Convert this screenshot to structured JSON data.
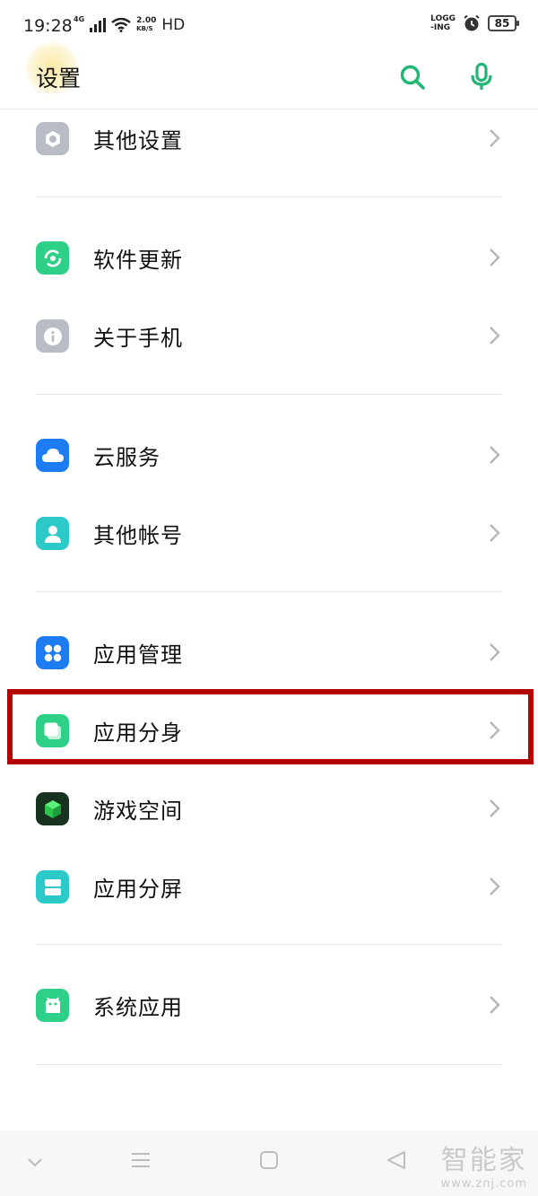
{
  "status_bar": {
    "time": "19:28",
    "network": "4G",
    "speed_value": "2.00",
    "speed_unit": "KB/S",
    "hd": "HD",
    "logging_line1": "LOGG",
    "logging_line2": "-ING",
    "battery": "85"
  },
  "header": {
    "title": "设置",
    "search_icon": "search-icon",
    "mic_icon": "microphone-icon",
    "accent_color": "#22b573"
  },
  "sections": [
    {
      "items": [
        {
          "label": "其他设置",
          "icon": "gear-icon",
          "icon_color": "#b8bcc4"
        }
      ]
    },
    {
      "items": [
        {
          "label": "软件更新",
          "icon": "update-icon",
          "icon_color": "#2ecf86"
        },
        {
          "label": "关于手机",
          "icon": "info-icon",
          "icon_color": "#b8bcc4"
        }
      ]
    },
    {
      "items": [
        {
          "label": "云服务",
          "icon": "cloud-icon",
          "icon_color": "#1e7cf2"
        },
        {
          "label": "其他帐号",
          "icon": "person-icon",
          "icon_color": "#2cc9c9"
        }
      ]
    },
    {
      "items": [
        {
          "label": "应用管理",
          "icon": "app-grid-icon",
          "icon_color": "#1e7cf2"
        },
        {
          "label": "应用分身",
          "icon": "clone-icon",
          "icon_color": "#2ecf86",
          "highlighted": true
        },
        {
          "label": "游戏空间",
          "icon": "game-cube-icon",
          "icon_color": "#1b5e2a"
        },
        {
          "label": "应用分屏",
          "icon": "split-screen-icon",
          "icon_color": "#2cc9c9"
        }
      ]
    },
    {
      "items": [
        {
          "label": "系统应用",
          "icon": "android-icon",
          "icon_color": "#2ecf86"
        }
      ]
    }
  ],
  "highlight_color": "#b30000",
  "nav_bar": {
    "buttons": [
      "chevron-down-icon",
      "menu-icon",
      "home-icon",
      "back-icon"
    ]
  },
  "watermark": {
    "name": "智能家",
    "url": "www.znj.com"
  }
}
